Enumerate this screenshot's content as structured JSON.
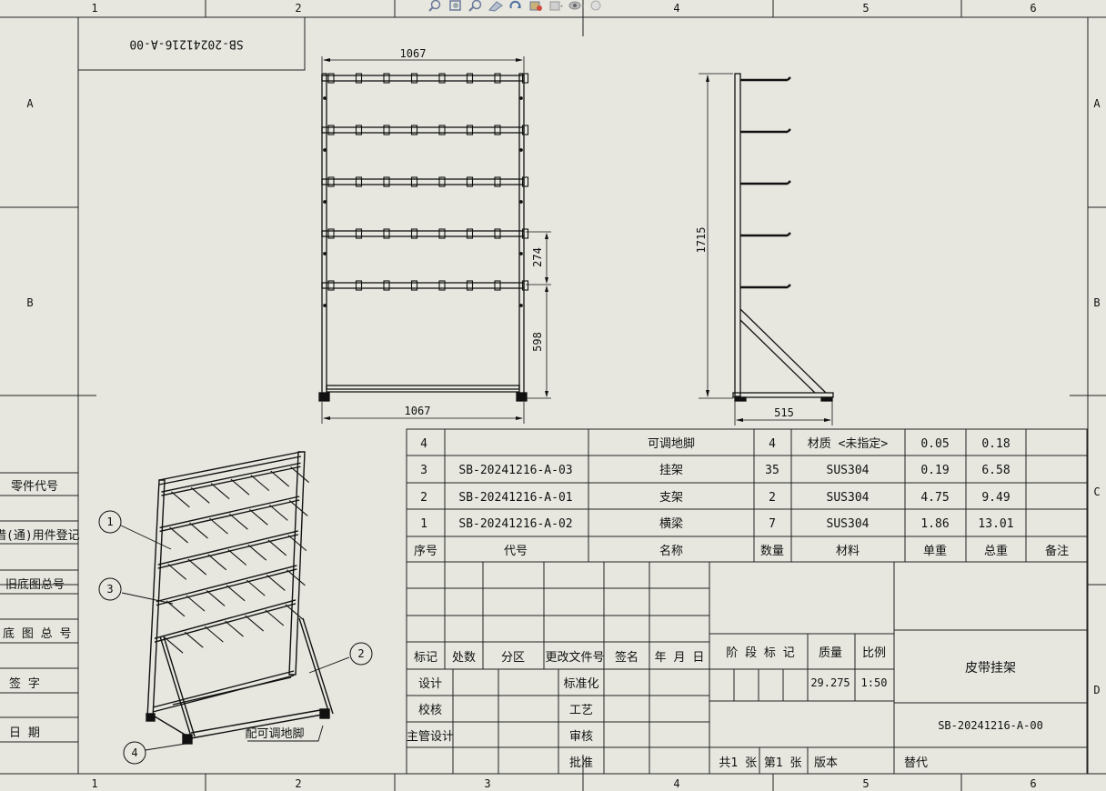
{
  "border": {
    "columns": [
      "1",
      "2",
      "3",
      "4",
      "5",
      "6"
    ],
    "rows": [
      "A",
      "B",
      "C",
      "D"
    ]
  },
  "drawing_number_mirror": "SB-20241216-A-00",
  "toolbar": {
    "icons": [
      "zoom-fit-icon",
      "zoom-area-icon",
      "previous-view-icon",
      "section-view-icon",
      "rotate-icon",
      "display-style-icon",
      "view-orientation-icon",
      "hide-show-icon",
      "appearance-icon"
    ]
  },
  "views": {
    "front": {
      "width_top": "1067",
      "width_bottom": "1067",
      "dim_274": "274",
      "dim_598": "598"
    },
    "side": {
      "height": "1715",
      "depth": "515"
    },
    "iso": {
      "balloon_1": "1",
      "balloon_2": "2",
      "balloon_3": "3",
      "balloon_4": "4",
      "note": "配可调地脚"
    }
  },
  "left_strip": {
    "part_code": "零件代号",
    "borrowed": "借(通)用件登记",
    "old_base": "旧底图总号",
    "base": "底 图 总 号",
    "sign": "签  字",
    "date": "日  期"
  },
  "bom": {
    "headers": {
      "seq": "序号",
      "code": "代号",
      "name": "名称",
      "qty": "数量",
      "material": "材料",
      "unit_wt": "单重",
      "total_wt": "总重",
      "remark": "备注"
    },
    "rows": [
      {
        "seq": "4",
        "code": "",
        "name": "可调地脚",
        "qty": "4",
        "material": "材质 <未指定>",
        "unit_wt": "0.05",
        "total_wt": "0.18",
        "remark": ""
      },
      {
        "seq": "3",
        "code": "SB-20241216-A-03",
        "name": "挂架",
        "qty": "35",
        "material": "SUS304",
        "unit_wt": "0.19",
        "total_wt": "6.58",
        "remark": ""
      },
      {
        "seq": "2",
        "code": "SB-20241216-A-01",
        "name": "支架",
        "qty": "2",
        "material": "SUS304",
        "unit_wt": "4.75",
        "total_wt": "9.49",
        "remark": ""
      },
      {
        "seq": "1",
        "code": "SB-20241216-A-02",
        "name": "横梁",
        "qty": "7",
        "material": "SUS304",
        "unit_wt": "1.86",
        "total_wt": "13.01",
        "remark": ""
      }
    ]
  },
  "title_block": {
    "mark": "标记",
    "count": "处数",
    "zone": "分区",
    "change_no": "更改文件号",
    "signature": "签名",
    "date": "年 月 日",
    "design": "设计",
    "standardization": "标准化",
    "check": "校核",
    "process": "工艺",
    "chief_design": "主管设计",
    "review": "审核",
    "approve": "批准",
    "stage_mark": "阶 段 标 记",
    "mass_label": "质量",
    "scale_label": "比例",
    "mass": "29.275",
    "scale": "1:50",
    "title": "皮带挂架",
    "drawing_no": "SB-20241216-A-00",
    "sheets": "共1 张  第1 张",
    "version": "版本",
    "replace": "替代"
  }
}
